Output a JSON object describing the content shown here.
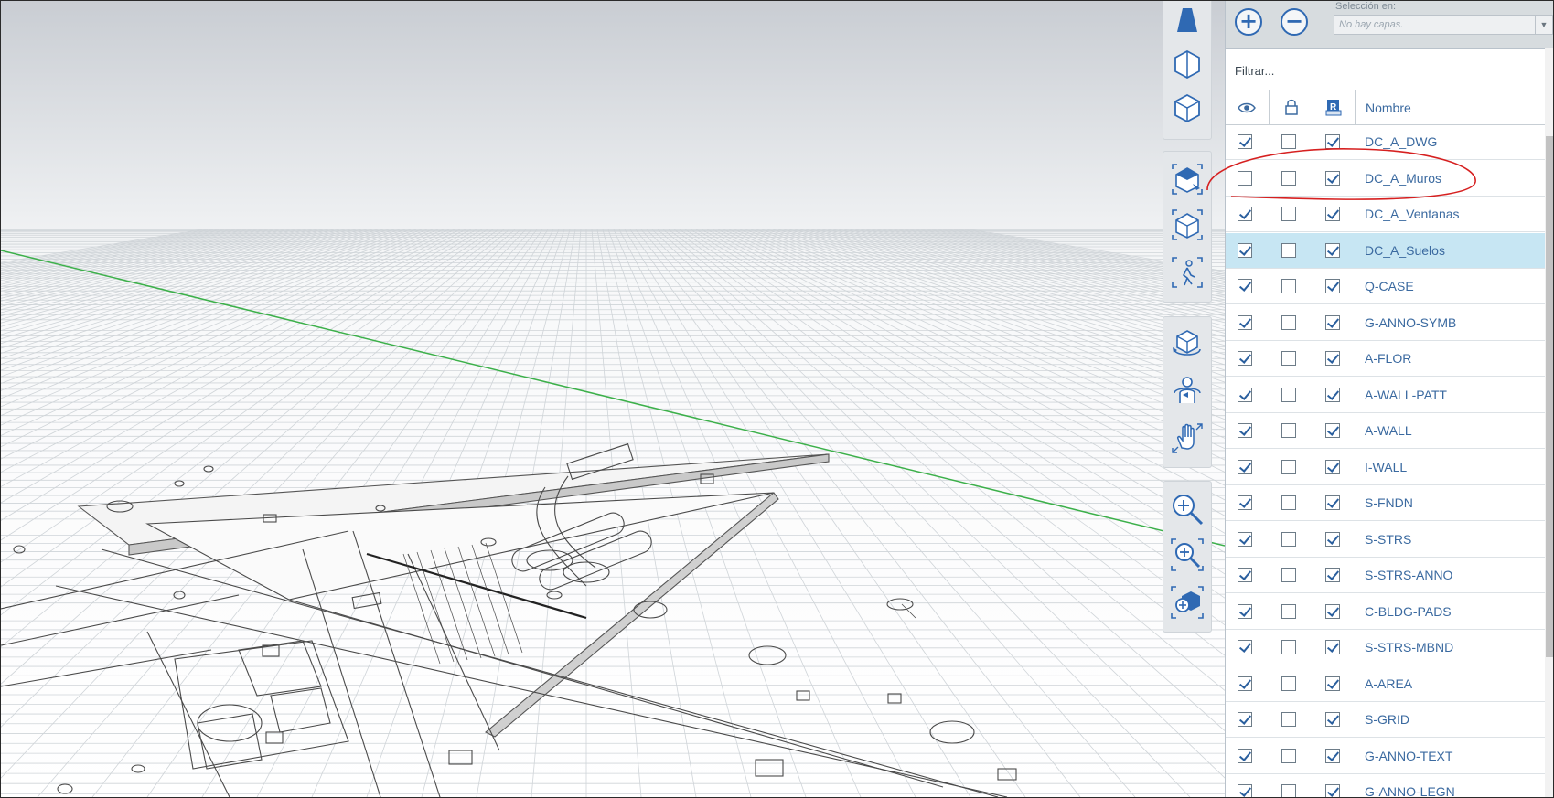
{
  "toolbar": {
    "groups": [
      {
        "buttons": [
          "perspective-view-icon",
          "front-view-icon",
          "isometric-view-icon"
        ]
      },
      {
        "buttons": [
          "default-3d-view-icon",
          "fit-view-icon",
          "walkthrough-view-icon"
        ]
      },
      {
        "buttons": [
          "orbit-icon",
          "look-around-icon",
          "pan-icon"
        ]
      },
      {
        "buttons": [
          "zoom-icon",
          "zoom-window-icon",
          "zoom-extents-icon"
        ]
      }
    ]
  },
  "layers_panel": {
    "add_button_icon": "plus-icon",
    "remove_button_icon": "minus-icon",
    "selection_label": "Selección en:",
    "selection_value": "No hay capas.",
    "filter_placeholder": "Filtrar...",
    "headers": {
      "visible_icon": "eye-icon",
      "lock_icon": "lock-icon",
      "revit_icon": "revit-icon",
      "name": "Nombre"
    },
    "rows": [
      {
        "name": "DC_A_DWG",
        "visible": true,
        "locked": false,
        "revit": true
      },
      {
        "name": "DC_A_Muros",
        "visible": false,
        "locked": false,
        "revit": true
      },
      {
        "name": "DC_A_Ventanas",
        "visible": true,
        "locked": false,
        "revit": true
      },
      {
        "name": "DC_A_Suelos",
        "visible": true,
        "locked": false,
        "revit": true,
        "selected": true
      },
      {
        "name": "Q-CASE",
        "visible": true,
        "locked": false,
        "revit": true
      },
      {
        "name": "G-ANNO-SYMB",
        "visible": true,
        "locked": false,
        "revit": true
      },
      {
        "name": "A-FLOR",
        "visible": true,
        "locked": false,
        "revit": true
      },
      {
        "name": "A-WALL-PATT",
        "visible": true,
        "locked": false,
        "revit": true
      },
      {
        "name": "A-WALL",
        "visible": true,
        "locked": false,
        "revit": true
      },
      {
        "name": "I-WALL",
        "visible": true,
        "locked": false,
        "revit": true
      },
      {
        "name": "S-FNDN",
        "visible": true,
        "locked": false,
        "revit": true
      },
      {
        "name": "S-STRS",
        "visible": true,
        "locked": false,
        "revit": true
      },
      {
        "name": "S-STRS-ANNO",
        "visible": true,
        "locked": false,
        "revit": true
      },
      {
        "name": "C-BLDG-PADS",
        "visible": true,
        "locked": false,
        "revit": true
      },
      {
        "name": "S-STRS-MBND",
        "visible": true,
        "locked": false,
        "revit": true
      },
      {
        "name": "A-AREA",
        "visible": true,
        "locked": false,
        "revit": true
      },
      {
        "name": "S-GRID",
        "visible": true,
        "locked": false,
        "revit": true
      },
      {
        "name": "G-ANNO-TEXT",
        "visible": true,
        "locked": false,
        "revit": true
      },
      {
        "name": "G-ANNO-LEGN",
        "visible": true,
        "locked": false,
        "revit": true
      }
    ]
  },
  "colors": {
    "accent": "#2f69b3",
    "selected_row": "#c7e6f3",
    "annotation": "#d62020",
    "axis_green": "#3cb04a"
  }
}
